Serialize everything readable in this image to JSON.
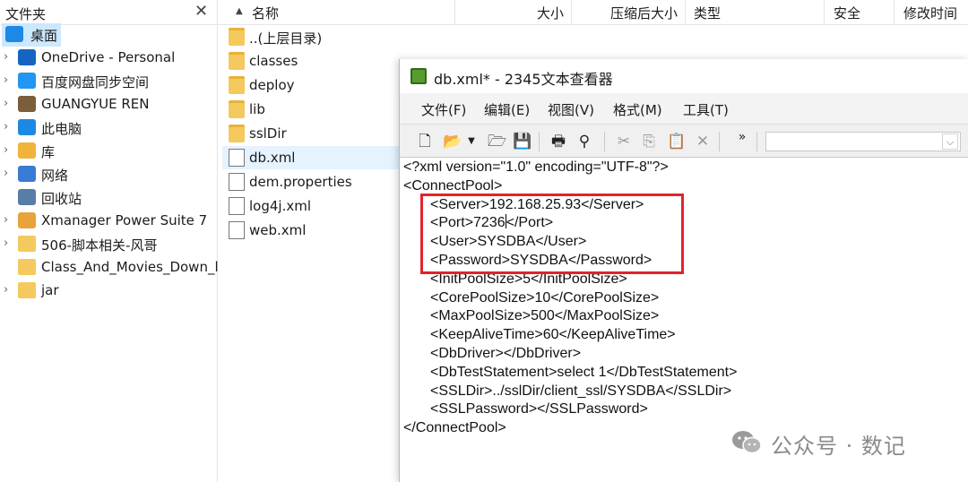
{
  "tree": {
    "header_title": "文件夹",
    "close_icon": "✕",
    "items": [
      {
        "label": "桌面",
        "icon": "desktop-icon",
        "chevron": ""
      },
      {
        "label": "OneDrive - Personal",
        "icon": "cloud-icon",
        "chevron": "›"
      },
      {
        "label": "百度网盘同步空间",
        "icon": "baidu-cloud-icon",
        "chevron": "›"
      },
      {
        "label": "GUANGYUE REN",
        "icon": "user-icon",
        "chevron": "›"
      },
      {
        "label": "此电脑",
        "icon": "computer-icon",
        "chevron": "›"
      },
      {
        "label": "库",
        "icon": "library-icon",
        "chevron": "›"
      },
      {
        "label": "网络",
        "icon": "network-icon",
        "chevron": "›"
      },
      {
        "label": "回收站",
        "icon": "recycle-bin-icon",
        "chevron": ""
      },
      {
        "label": "Xmanager Power Suite 7",
        "icon": "xmanager-icon",
        "chevron": "›"
      },
      {
        "label": "506-脚本相关-风哥",
        "icon": "folder-icon",
        "chevron": "›"
      },
      {
        "label": "Class_And_Movies_Down_l",
        "icon": "folder-icon",
        "chevron": ""
      },
      {
        "label": "jar",
        "icon": "folder-icon",
        "chevron": "›"
      }
    ]
  },
  "file_list": {
    "sort_arrow": "▲",
    "columns": {
      "name": "名称",
      "size": "大小",
      "compressed": "压缩后大小",
      "type": "类型",
      "security": "安全",
      "modified": "修改时间"
    },
    "rows": [
      {
        "label": "..(上层目录)",
        "kind": "folder"
      },
      {
        "label": "classes",
        "kind": "folder"
      },
      {
        "label": "deploy",
        "kind": "folder"
      },
      {
        "label": "lib",
        "kind": "folder"
      },
      {
        "label": "sslDir",
        "kind": "folder"
      },
      {
        "label": "db.xml",
        "kind": "file"
      },
      {
        "label": "dem.properties",
        "kind": "file"
      },
      {
        "label": "log4j.xml",
        "kind": "file"
      },
      {
        "label": "web.xml",
        "kind": "file"
      }
    ]
  },
  "editor": {
    "title": "db.xml* - 2345文本查看器",
    "menu": [
      "文件(F)",
      "编辑(E)",
      "视图(V)",
      "格式(M)",
      "工具(T)"
    ],
    "toolbar_overflow": "»",
    "search_placeholder": "",
    "lines": [
      "<?xml version=\"1.0\" encoding=\"UTF-8\"?>",
      "<ConnectPool>",
      "<Server>192.168.25.93</Server>",
      "<Port>7236|</Port>",
      "<User>SYSDBA</User>",
      "<Password>SYSDBA</Password>",
      "<InitPoolSize>5</InitPoolSize>",
      "<CorePoolSize>10</CorePoolSize>",
      "<MaxPoolSize>500</MaxPoolSize>",
      "<KeepAliveTime>60</KeepAliveTime>",
      "<DbDriver></DbDriver>",
      "<DbTestStatement>select 1</DbTestStatement>",
      "<SSLDir>../sslDir/client_ssl/SYSDBA</SSLDir>",
      "<SSLPassword></SSLPassword>",
      "</ConnectPool>"
    ],
    "line_indented": [
      false,
      false,
      true,
      true,
      true,
      true,
      true,
      true,
      true,
      true,
      true,
      true,
      true,
      true,
      false
    ],
    "highlight_color": "#e0242a"
  },
  "watermark": {
    "text": "公众号 · 数记",
    "icon": "wechat-icon"
  }
}
